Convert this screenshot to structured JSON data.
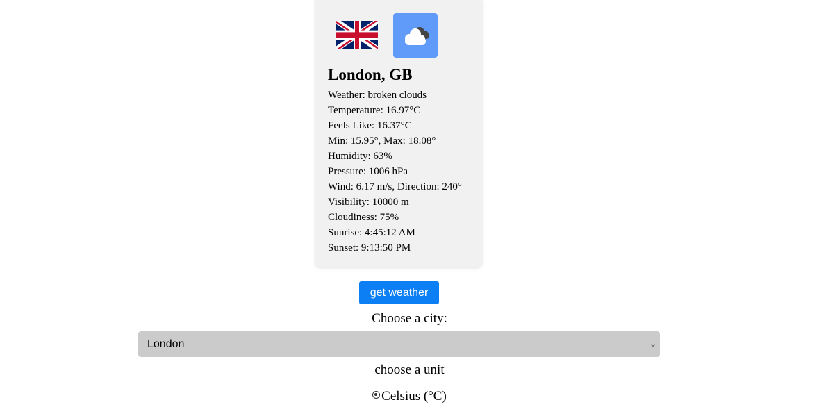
{
  "card": {
    "flag_icon": "uk-flag-icon",
    "weather_icon": "broken-clouds-icon",
    "weather_icon_bg": "#619bf9",
    "city_title": "London, GB",
    "details": [
      "Weather: broken clouds",
      "Temperature: 16.97°C",
      "Feels Like: 16.37°C",
      "Min: 15.95°, Max: 18.08°",
      "Humidity: 63%",
      "Pressure: 1006 hPa",
      "Wind: 6.17 m/s, Direction: 240°",
      "Visibility: 10000 m",
      "Cloudiness: 75%",
      "Sunrise: 4:45:12 AM",
      "Sunset: 9:13:50 PM"
    ]
  },
  "controls": {
    "get_weather_label": "get weather",
    "button_color": "#0d7ff5",
    "choose_city_label": "Choose a city:",
    "city_select_value": "London",
    "choose_unit_label": "choose a unit",
    "unit_option_label": "Celsius (°C)",
    "unit_option_checked": true
  }
}
